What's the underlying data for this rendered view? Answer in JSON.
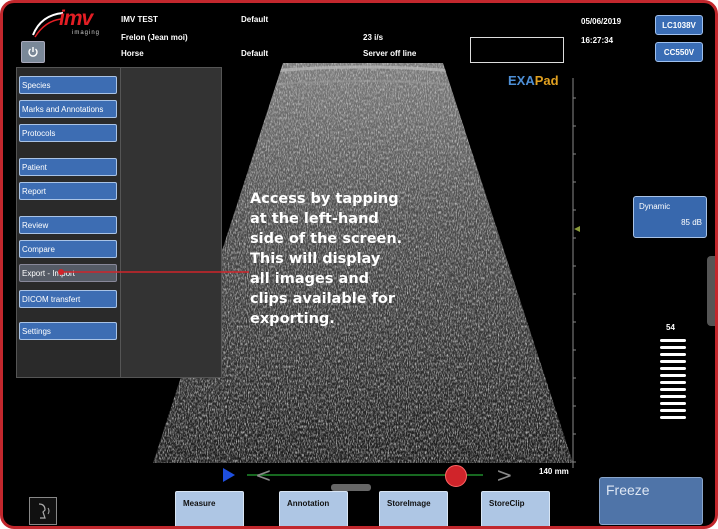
{
  "header": {
    "logo_text": "imv",
    "logo_sub": "imaging",
    "col1": [
      "IMV TEST",
      "Frelon (Jean moi)",
      "Horse"
    ],
    "col2_top": "Default",
    "col2_bottom": "Default",
    "frame_rate": "23 i/s",
    "server_status": "Server off line",
    "date": "05/06/2019",
    "time": "16:27:34",
    "probe_buttons": [
      "LC1038V",
      "CC550V"
    ]
  },
  "menu": {
    "items": [
      "Species",
      "Marks and Annotations",
      "Protocols",
      "Patient",
      "Report",
      "Review",
      "Compare",
      "Export - Import",
      "DICOM transfert",
      "Settings"
    ],
    "highlighted": "Export - Import"
  },
  "brand": {
    "exa": "EXA",
    "pad": "Pad"
  },
  "callout": {
    "lines": [
      "Access by tapping",
      "at the left-hand",
      "side of the screen.",
      "This will display",
      "all images and",
      "clips available for",
      "exporting."
    ]
  },
  "dynamic": {
    "label": "Dynamic",
    "value": "85 dB"
  },
  "gain": {
    "value": "54"
  },
  "cine": {
    "depth_label": "140 mm",
    "prev": "<",
    "next": ">",
    "position": 0.92
  },
  "bottom_buttons": [
    "Measure",
    "Annotation",
    "StoreImage",
    "StoreClip"
  ],
  "freeze_label": "Freeze",
  "colors": {
    "accent_red": "#c2272d",
    "button_blue": "#3d6db3",
    "bottom_button": "#aec6e4",
    "freeze_blue": "#4f74a8"
  }
}
